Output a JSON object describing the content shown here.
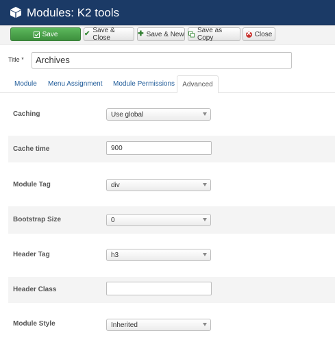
{
  "header": {
    "title": "Modules: K2 tools",
    "icon": "cube-icon",
    "background": "#1b3a66"
  },
  "toolbar": {
    "save_label": "Save",
    "save_close_label": "Save & Close",
    "save_new_label": "Save & New",
    "save_copy_label": "Save as Copy",
    "close_label": "Close",
    "save_color": "#4cae4c",
    "close_icon_color": "#c9302c"
  },
  "form": {
    "title_label": "Title",
    "required_mark": "*",
    "title_value": "Archives"
  },
  "tabs": {
    "module": "Module",
    "menu_assignment": "Menu Assignment",
    "module_permissions": "Module Permissions",
    "advanced": "Advanced",
    "active": "Advanced"
  },
  "advanced": {
    "caching_label": "Caching",
    "caching_value": "Use global",
    "cache_time_label": "Cache time",
    "cache_time_value": "900",
    "module_tag_label": "Module Tag",
    "module_tag_value": "div",
    "bootstrap_size_label": "Bootstrap Size",
    "bootstrap_size_value": "0",
    "header_tag_label": "Header Tag",
    "header_tag_value": "h3",
    "header_class_label": "Header Class",
    "header_class_value": "",
    "module_style_label": "Module Style",
    "module_style_value": "Inherited"
  }
}
